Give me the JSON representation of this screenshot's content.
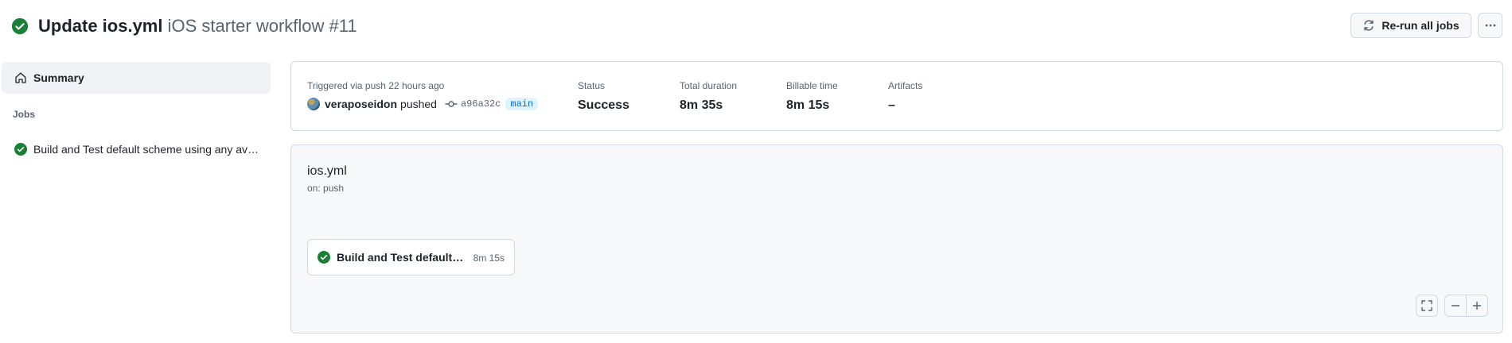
{
  "header": {
    "title_bold": "Update ios.yml",
    "title_light": "iOS starter workflow #11",
    "rerun_label": "Re-run all jobs",
    "status_icon": "check-circle-fill-icon"
  },
  "sidebar": {
    "summary_label": "Summary",
    "jobs_heading": "Jobs",
    "jobs": [
      {
        "label": "Build and Test default scheme using any available iPhone simulator",
        "status": "success"
      }
    ]
  },
  "summary": {
    "trigger_label": "Triggered via push 22 hours ago",
    "actor": "veraposeidon",
    "action": "pushed",
    "sha": "a96a32c",
    "branch": "main",
    "status_label": "Status",
    "status_value": "Success",
    "duration_label": "Total duration",
    "duration_value": "8m 35s",
    "billable_label": "Billable time",
    "billable_value": "8m 15s",
    "artifacts_label": "Artifacts",
    "artifacts_value": "–"
  },
  "graph": {
    "workflow_file": "ios.yml",
    "workflow_trigger": "on: push",
    "job": {
      "name": "Build and Test default scheme using any available iPhone simulator",
      "duration": "8m 15s"
    }
  },
  "colors": {
    "success": "#1a7f37",
    "border": "#d1d9e0",
    "muted": "#59636e",
    "link": "#0969da"
  }
}
